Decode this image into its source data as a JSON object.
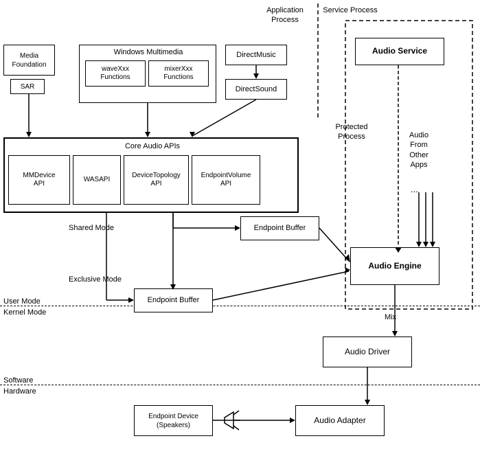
{
  "header": {
    "app_process": "Application\nProcess",
    "service_process": "Service\nProcess",
    "protected_process": "Protected\nProcess"
  },
  "boxes": {
    "media_foundation": "Media\nFoundation",
    "sar": "SAR",
    "windows_multimedia": "Windows Multimedia",
    "wave_xxx": "waveXxx\nFunctions",
    "mixer_xxx": "mixerXxx\nFunctions",
    "direct_music": "DirectMusic",
    "direct_sound": "DirectSound",
    "audio_service": "Audio Service",
    "core_audio": "Core Audio APIs",
    "mmdevice": "MMDevice\nAPI",
    "wasapi": "WASAPI",
    "device_topology": "DeviceTopology\nAPI",
    "endpoint_volume": "EndpointVolume\nAPI",
    "endpoint_buffer_shared": "Endpoint Buffer",
    "audio_engine": "Audio Engine",
    "audio_from_other": "Audio\nFrom\nOther\nApps",
    "ellipsis": "...",
    "endpoint_buffer_exclusive": "Endpoint Buffer",
    "audio_driver": "Audio Driver",
    "endpoint_device": "Endpoint Device\n(Speakers)",
    "audio_adapter": "Audio Adapter"
  },
  "labels": {
    "shared_mode": "Shared Mode",
    "exclusive_mode": "Exclusive Mode",
    "user_mode": "User Mode",
    "kernel_mode": "Kernel Mode",
    "software": "Software",
    "hardware": "Hardware",
    "mix": "Mix"
  }
}
